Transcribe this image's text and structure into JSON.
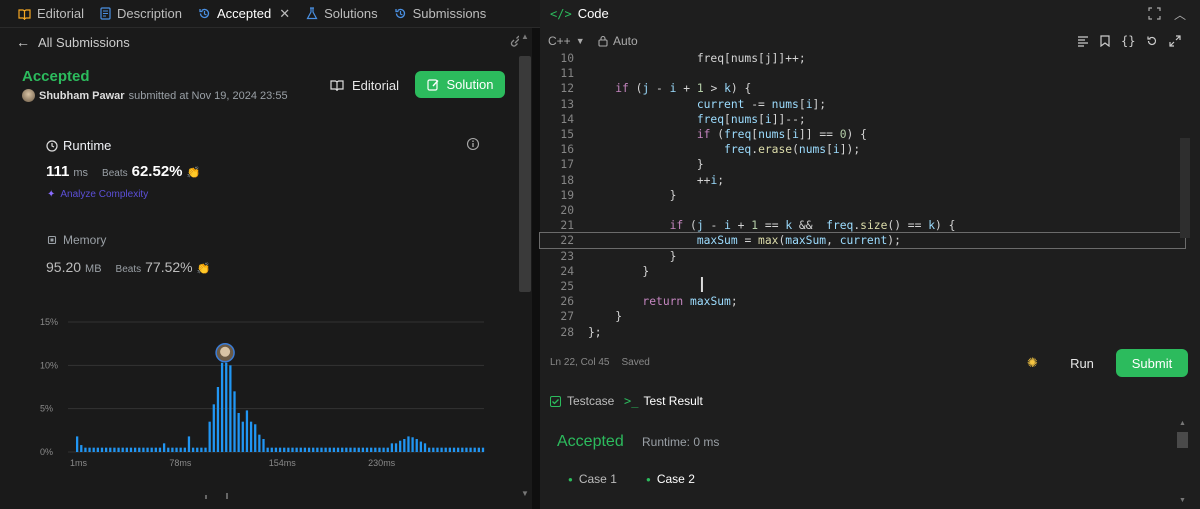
{
  "left_tabs": [
    {
      "label": "Editorial",
      "icon": "book-icon"
    },
    {
      "label": "Description",
      "icon": "document-icon"
    },
    {
      "label": "Accepted",
      "icon": "history-icon",
      "active": true
    },
    {
      "label": "Solutions",
      "icon": "flask-icon"
    },
    {
      "label": "Submissions",
      "icon": "history-icon"
    }
  ],
  "submission": {
    "back_label": "All Submissions",
    "status": "Accepted",
    "user": "Shubham Pawar",
    "submitted_text": "submitted at Nov 19, 2024 23:55",
    "editorial_label": "Editorial",
    "solution_label": "Solution",
    "runtime_title": "Runtime",
    "runtime_value": "111",
    "runtime_unit": "ms",
    "beats_label": "Beats",
    "runtime_beats": "62.52%",
    "analyze_label": "Analyze Complexity",
    "memory_title": "Memory",
    "memory_value": "95.20",
    "memory_unit": "MB",
    "memory_beats": "77.52%"
  },
  "chart_data": {
    "type": "bar",
    "y_tick_labels": [
      "15%",
      "10%",
      "5%",
      "0%"
    ],
    "y_ticks": [
      15,
      10,
      5,
      0
    ],
    "x_tick_labels": [
      "1ms",
      "78ms",
      "154ms",
      "230ms"
    ],
    "ylim": [
      0,
      15
    ],
    "values": [
      1.8,
      0.8,
      0.5,
      0.5,
      0.5,
      0.5,
      0.5,
      0.5,
      0.5,
      0.5,
      0.5,
      0.5,
      0.5,
      0.5,
      0.5,
      0.5,
      0.5,
      0.5,
      0.5,
      0.5,
      0.5,
      1.0,
      0.5,
      0.5,
      0.5,
      0.5,
      0.5,
      1.8,
      0.5,
      0.5,
      0.5,
      0.5,
      3.5,
      5.5,
      7.5,
      10.3,
      10.3,
      10.0,
      7.0,
      4.5,
      3.5,
      4.8,
      3.5,
      3.2,
      2.0,
      1.5,
      0.5,
      0.5,
      0.5,
      0.5,
      0.5,
      0.5,
      0.5,
      0.5,
      0.5,
      0.5,
      0.5,
      0.5,
      0.5,
      0.5,
      0.5,
      0.5,
      0.5,
      0.5,
      0.5,
      0.5,
      0.5,
      0.5,
      0.5,
      0.5,
      0.5,
      0.5,
      0.5,
      0.5,
      0.5,
      0.5,
      1.0,
      1.0,
      1.3,
      1.5,
      1.8,
      1.7,
      1.5,
      1.2,
      1.0,
      0.5,
      0.5,
      0.5,
      0.5,
      0.5,
      0.5,
      0.5,
      0.5,
      0.5,
      0.5,
      0.5,
      0.5,
      0.5,
      0.5
    ],
    "highlight_index": 36,
    "bar_color": "#2196f3",
    "grid": true
  },
  "right": {
    "code_tab": "Code",
    "language": "C++",
    "mode": "Auto",
    "status": "Ln 22, Col 45",
    "saved": "Saved",
    "run_label": "Run",
    "submit_label": "Submit",
    "testcase_tab": "Testcase",
    "testresult_tab": "Test Result",
    "result_status": "Accepted",
    "result_runtime": "Runtime: 0 ms",
    "cases": [
      "Case 1",
      "Case 2"
    ]
  },
  "code_lines": [
    {
      "n": "10",
      "html": "                freq[nums[j]]++;"
    },
    {
      "n": "11",
      "html": ""
    },
    {
      "n": "12",
      "html": "    <span class='kw'>if</span> (<span class='var'>j</span> - <span class='var'>i</span> + <span class='num'>1</span> > <span class='var'>k</span>) {"
    },
    {
      "n": "13",
      "html": "                <span class='var'>current</span> -= <span class='var'>nums</span>[<span class='var'>i</span>];"
    },
    {
      "n": "14",
      "html": "                <span class='var'>freq</span>[<span class='var'>nums</span>[<span class='var'>i</span>]]--;"
    },
    {
      "n": "15",
      "html": "                <span class='kw'>if</span> (<span class='var'>freq</span>[<span class='var'>nums</span>[<span class='var'>i</span>]] == <span class='num'>0</span>) {"
    },
    {
      "n": "16",
      "html": "                    <span class='var'>freq</span>.<span class='fn'>erase</span>(<span class='var'>nums</span>[<span class='var'>i</span>]);"
    },
    {
      "n": "17",
      "html": "                }"
    },
    {
      "n": "18",
      "html": "                ++<span class='var'>i</span>;"
    },
    {
      "n": "19",
      "html": "            }"
    },
    {
      "n": "20",
      "html": ""
    },
    {
      "n": "21",
      "html": "            <span class='kw'>if</span> (<span class='var'>j</span> - <span class='var'>i</span> + <span class='num'>1</span> == <span class='var'>k</span> &&  <span class='var'>freq</span>.<span class='fn'>size</span>() == <span class='var'>k</span>) {"
    },
    {
      "n": "22",
      "html": "                <span class='var'>maxSum</span> = <span class='fn'>max</span>(<span class='var'>maxSum</span>, <span class='var'>current</span>);"
    },
    {
      "n": "23",
      "html": "            }"
    },
    {
      "n": "24",
      "html": "        }"
    },
    {
      "n": "25",
      "html": ""
    },
    {
      "n": "26",
      "html": "        <span class='kw'>return</span> <span class='var'>maxSum</span>;"
    },
    {
      "n": "27",
      "html": "    }"
    },
    {
      "n": "28",
      "html": "};"
    }
  ]
}
